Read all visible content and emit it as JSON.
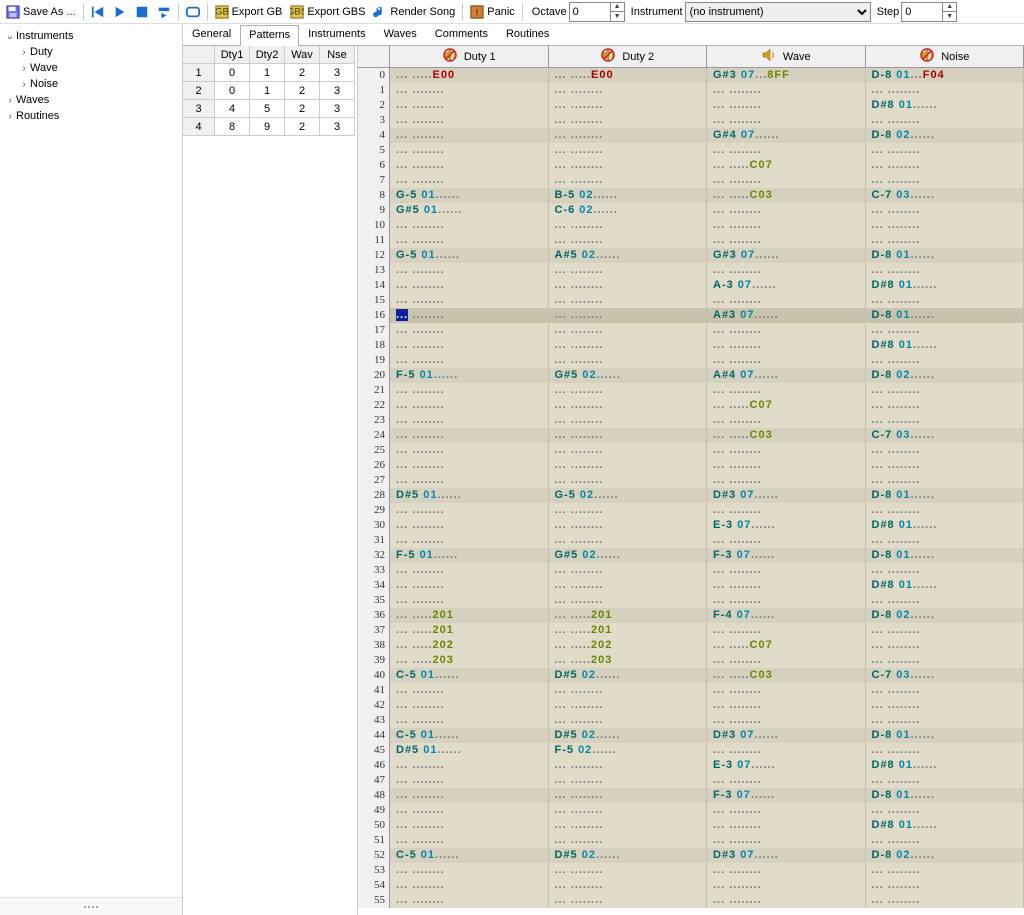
{
  "toolbar": {
    "save_label": "Save As ...",
    "export_gb_label": "Export GB",
    "export_gbs_label": "Export GBS",
    "render_song_label": "Render Song",
    "panic_label": "Panic",
    "octave_label": "Octave",
    "octave_value": "0",
    "instrument_label": "Instrument",
    "instrument_value": "(no instrument)",
    "step_label": "Step",
    "step_value": "0"
  },
  "tree": {
    "item1": {
      "label": "Instruments",
      "expanded": true
    },
    "item1_c": [
      {
        "label": "Duty"
      },
      {
        "label": "Wave"
      },
      {
        "label": "Noise"
      }
    ],
    "item2": {
      "label": "Waves"
    },
    "item3": {
      "label": "Routines"
    }
  },
  "tabs": [
    "General",
    "Patterns",
    "Instruments",
    "Waves",
    "Comments",
    "Routines"
  ],
  "active_tab": "Patterns",
  "pattern_table": {
    "headers": [
      "Dty1",
      "Dty2",
      "Wav",
      "Nse"
    ],
    "rows": [
      {
        "idx": "1",
        "cells": [
          "0",
          "1",
          "2",
          "3"
        ]
      },
      {
        "idx": "2",
        "cells": [
          "0",
          "1",
          "2",
          "3"
        ]
      },
      {
        "idx": "3",
        "cells": [
          "4",
          "5",
          "2",
          "3"
        ]
      },
      {
        "idx": "4",
        "cells": [
          "8",
          "9",
          "2",
          "3"
        ]
      }
    ]
  },
  "tracker": {
    "channels": [
      "Duty 1",
      "Duty 2",
      "Wave",
      "Noise"
    ],
    "mute": [
      true,
      true,
      false,
      true
    ],
    "rows": [
      {
        "n": 0,
        "c": [
          {
            "fx": "E00",
            "fxc": "fxr"
          },
          {
            "fx": "E00",
            "fxc": "fxr"
          },
          {
            "note": "G#3",
            "inst": "07",
            "fx": "8FF"
          },
          {
            "note": "D-8",
            "inst": "01",
            "fx": "F04",
            "fxc": "fxr"
          }
        ]
      },
      {
        "n": 1,
        "c": [
          {},
          {},
          {},
          {}
        ]
      },
      {
        "n": 2,
        "c": [
          {},
          {},
          {},
          {
            "note": "D#8",
            "inst": "01"
          }
        ]
      },
      {
        "n": 3,
        "c": [
          {},
          {},
          {},
          {}
        ]
      },
      {
        "n": 4,
        "c": [
          {},
          {},
          {
            "note": "G#4",
            "inst": "07"
          },
          {
            "note": "D-8",
            "inst": "02"
          }
        ]
      },
      {
        "n": 5,
        "c": [
          {},
          {},
          {},
          {}
        ]
      },
      {
        "n": 6,
        "c": [
          {},
          {},
          {
            "fx": "C07"
          },
          {}
        ]
      },
      {
        "n": 7,
        "c": [
          {},
          {},
          {},
          {}
        ]
      },
      {
        "n": 8,
        "c": [
          {
            "note": "G-5",
            "inst": "01"
          },
          {
            "note": "B-5",
            "inst": "02"
          },
          {
            "fx": "C03"
          },
          {
            "note": "C-7",
            "inst": "03"
          }
        ]
      },
      {
        "n": 9,
        "c": [
          {
            "note": "G#5",
            "inst": "01"
          },
          {
            "note": "C-6",
            "inst": "02"
          },
          {},
          {}
        ]
      },
      {
        "n": 10,
        "c": [
          {},
          {},
          {},
          {}
        ]
      },
      {
        "n": 11,
        "c": [
          {},
          {},
          {},
          {}
        ]
      },
      {
        "n": 12,
        "c": [
          {
            "note": "G-5",
            "inst": "01"
          },
          {
            "note": "A#5",
            "inst": "02"
          },
          {
            "note": "G#3",
            "inst": "07"
          },
          {
            "note": "D-8",
            "inst": "01"
          }
        ]
      },
      {
        "n": 13,
        "c": [
          {},
          {},
          {},
          {}
        ]
      },
      {
        "n": 14,
        "c": [
          {},
          {},
          {
            "note": "A-3",
            "inst": "07"
          },
          {
            "note": "D#8",
            "inst": "01"
          }
        ]
      },
      {
        "n": 15,
        "c": [
          {},
          {},
          {},
          {}
        ]
      },
      {
        "n": 16,
        "c": [
          {
            "sel": true
          },
          {},
          {
            "note": "A#3",
            "inst": "07"
          },
          {
            "note": "D-8",
            "inst": "01"
          }
        ]
      },
      {
        "n": 17,
        "c": [
          {},
          {},
          {},
          {}
        ]
      },
      {
        "n": 18,
        "c": [
          {},
          {},
          {},
          {
            "note": "D#8",
            "inst": "01"
          }
        ]
      },
      {
        "n": 19,
        "c": [
          {},
          {},
          {},
          {}
        ]
      },
      {
        "n": 20,
        "c": [
          {
            "note": "F-5",
            "inst": "01"
          },
          {
            "note": "G#5",
            "inst": "02"
          },
          {
            "note": "A#4",
            "inst": "07"
          },
          {
            "note": "D-8",
            "inst": "02"
          }
        ]
      },
      {
        "n": 21,
        "c": [
          {},
          {},
          {},
          {}
        ]
      },
      {
        "n": 22,
        "c": [
          {},
          {},
          {
            "fx": "C07"
          },
          {}
        ]
      },
      {
        "n": 23,
        "c": [
          {},
          {},
          {},
          {}
        ]
      },
      {
        "n": 24,
        "c": [
          {},
          {},
          {
            "fx": "C03"
          },
          {
            "note": "C-7",
            "inst": "03"
          }
        ]
      },
      {
        "n": 25,
        "c": [
          {},
          {},
          {},
          {}
        ]
      },
      {
        "n": 26,
        "c": [
          {},
          {},
          {},
          {}
        ]
      },
      {
        "n": 27,
        "c": [
          {},
          {},
          {},
          {}
        ]
      },
      {
        "n": 28,
        "c": [
          {
            "note": "D#5",
            "inst": "01"
          },
          {
            "note": "G-5",
            "inst": "02"
          },
          {
            "note": "D#3",
            "inst": "07"
          },
          {
            "note": "D-8",
            "inst": "01"
          }
        ]
      },
      {
        "n": 29,
        "c": [
          {},
          {},
          {},
          {}
        ]
      },
      {
        "n": 30,
        "c": [
          {},
          {},
          {
            "note": "E-3",
            "inst": "07"
          },
          {
            "note": "D#8",
            "inst": "01"
          }
        ]
      },
      {
        "n": 31,
        "c": [
          {},
          {},
          {},
          {}
        ]
      },
      {
        "n": 32,
        "c": [
          {
            "note": "F-5",
            "inst": "01"
          },
          {
            "note": "G#5",
            "inst": "02"
          },
          {
            "note": "F-3",
            "inst": "07"
          },
          {
            "note": "D-8",
            "inst": "01"
          }
        ]
      },
      {
        "n": 33,
        "c": [
          {},
          {},
          {},
          {}
        ]
      },
      {
        "n": 34,
        "c": [
          {},
          {},
          {},
          {
            "note": "D#8",
            "inst": "01"
          }
        ]
      },
      {
        "n": 35,
        "c": [
          {},
          {},
          {},
          {}
        ]
      },
      {
        "n": 36,
        "c": [
          {
            "fx": "201"
          },
          {
            "fx": "201"
          },
          {
            "note": "F-4",
            "inst": "07"
          },
          {
            "note": "D-8",
            "inst": "02"
          }
        ]
      },
      {
        "n": 37,
        "c": [
          {
            "fx": "201"
          },
          {
            "fx": "201"
          },
          {},
          {}
        ]
      },
      {
        "n": 38,
        "c": [
          {
            "fx": "202"
          },
          {
            "fx": "202"
          },
          {
            "fx": "C07"
          },
          {}
        ]
      },
      {
        "n": 39,
        "c": [
          {
            "fx": "203"
          },
          {
            "fx": "203"
          },
          {},
          {}
        ]
      },
      {
        "n": 40,
        "c": [
          {
            "note": "C-5",
            "inst": "01"
          },
          {
            "note": "D#5",
            "inst": "02"
          },
          {
            "fx": "C03"
          },
          {
            "note": "C-7",
            "inst": "03"
          }
        ]
      },
      {
        "n": 41,
        "c": [
          {},
          {},
          {},
          {}
        ]
      },
      {
        "n": 42,
        "c": [
          {},
          {},
          {},
          {}
        ]
      },
      {
        "n": 43,
        "c": [
          {},
          {},
          {},
          {}
        ]
      },
      {
        "n": 44,
        "c": [
          {
            "note": "C-5",
            "inst": "01"
          },
          {
            "note": "D#5",
            "inst": "02"
          },
          {
            "note": "D#3",
            "inst": "07"
          },
          {
            "note": "D-8",
            "inst": "01"
          }
        ]
      },
      {
        "n": 45,
        "c": [
          {
            "note": "D#5",
            "inst": "01"
          },
          {
            "note": "F-5",
            "inst": "02"
          },
          {},
          {}
        ]
      },
      {
        "n": 46,
        "c": [
          {},
          {},
          {
            "note": "E-3",
            "inst": "07"
          },
          {
            "note": "D#8",
            "inst": "01"
          }
        ]
      },
      {
        "n": 47,
        "c": [
          {},
          {},
          {},
          {}
        ]
      },
      {
        "n": 48,
        "c": [
          {},
          {},
          {
            "note": "F-3",
            "inst": "07"
          },
          {
            "note": "D-8",
            "inst": "01"
          }
        ]
      },
      {
        "n": 49,
        "c": [
          {},
          {},
          {},
          {}
        ]
      },
      {
        "n": 50,
        "c": [
          {},
          {},
          {},
          {
            "note": "D#8",
            "inst": "01"
          }
        ]
      },
      {
        "n": 51,
        "c": [
          {},
          {},
          {},
          {}
        ]
      },
      {
        "n": 52,
        "c": [
          {
            "note": "C-5",
            "inst": "01"
          },
          {
            "note": "D#5",
            "inst": "02"
          },
          {
            "note": "D#3",
            "inst": "07"
          },
          {
            "note": "D-8",
            "inst": "02"
          }
        ]
      },
      {
        "n": 53,
        "c": [
          {},
          {},
          {},
          {}
        ]
      },
      {
        "n": 54,
        "c": [
          {},
          {},
          {},
          {}
        ]
      },
      {
        "n": 55,
        "c": [
          {},
          {},
          {},
          {}
        ]
      }
    ]
  }
}
